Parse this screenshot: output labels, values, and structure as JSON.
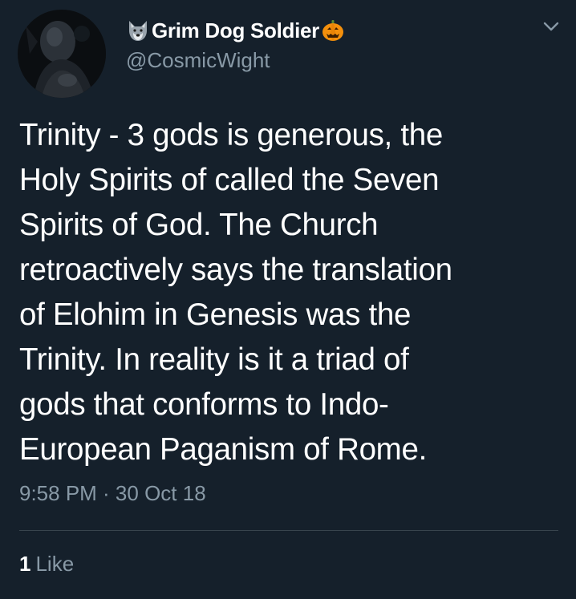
{
  "author": {
    "display_name": "Grim Dog Soldier",
    "name_prefix_icon": "wolf-face-icon",
    "name_suffix_icon": "jack-o-lantern-icon",
    "handle": "@CosmicWight"
  },
  "menu": {
    "icon": "chevron-down-icon"
  },
  "tweet": {
    "lines": [
      "Trinity - 3 gods is generous, the",
      "Holy Spirits of called the Seven",
      "Spirits of God. The Church",
      "retroactively says the translation",
      "of Elohim in Genesis was the",
      "Trinity. In reality is it a triad of",
      "gods that conforms to Indo-",
      "European Paganism of Rome."
    ],
    "timestamp": "9:58 PM · 30 Oct 18"
  },
  "stats": {
    "likes_count": "1",
    "likes_label": "Like"
  },
  "colors": {
    "background": "#15202b",
    "primary_text": "#ffffff",
    "secondary_text": "#8899a6",
    "divider": "#38444d"
  }
}
